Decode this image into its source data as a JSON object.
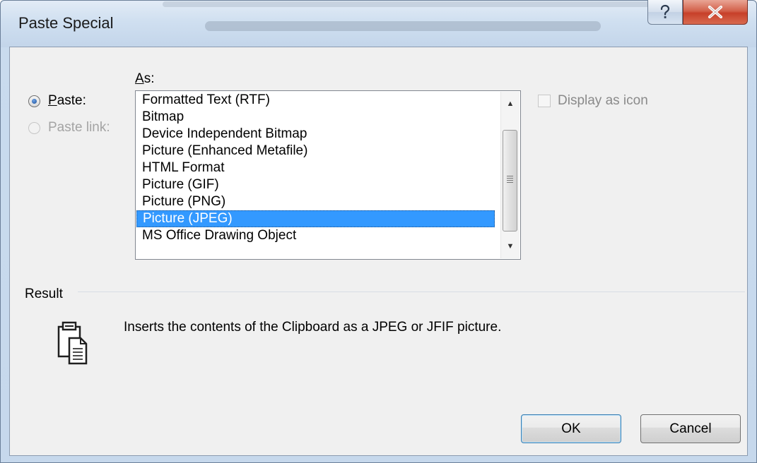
{
  "window": {
    "title": "Paste Special"
  },
  "options": {
    "as_label_prefix": "",
    "as_label_mnemonic": "A",
    "as_label_rest": "s:",
    "paste_mnemonic": "P",
    "paste_rest": "aste:",
    "paste_selected": true,
    "paste_link_label": "Paste link:",
    "paste_link_enabled": false
  },
  "format_list": {
    "items": [
      "Formatted Text (RTF)",
      "Bitmap",
      "Device Independent Bitmap",
      "Picture (Enhanced Metafile)",
      "HTML Format",
      "Picture (GIF)",
      "Picture (PNG)",
      "Picture (JPEG)",
      "MS Office Drawing Object"
    ],
    "selected": "Picture (JPEG)"
  },
  "display_as_icon": {
    "label": "Display as icon",
    "checked": false,
    "enabled": false
  },
  "result": {
    "heading": "Result",
    "description": "Inserts the contents of the Clipboard as a JPEG or JFIF picture.",
    "icon": "clipboard-paste-icon"
  },
  "buttons": {
    "ok": "OK",
    "cancel": "Cancel"
  },
  "colors": {
    "selection": "#3399ff",
    "close_button": "#c7402a",
    "title_bar": "#cfdff0"
  }
}
